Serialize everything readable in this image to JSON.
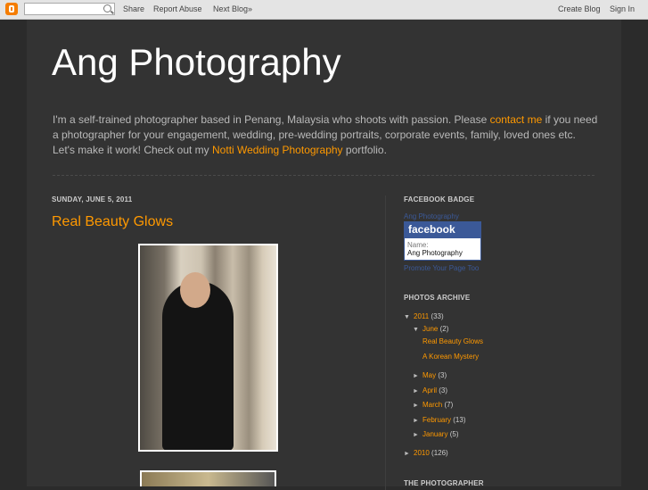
{
  "navbar": {
    "share": "Share",
    "report": "Report Abuse",
    "next": "Next Blog»",
    "create": "Create Blog",
    "signin": "Sign In",
    "search_placeholder": ""
  },
  "header": {
    "title": "Ang Photography",
    "desc_1": "I'm a self-trained photographer based in Penang, Malaysia who shoots with passion. Please ",
    "contact_link": "contact me",
    "desc_2": " if you need a photographer for your engagement, wedding, pre-wedding portraits, corporate events, family, loved ones etc. Let's make it work! Check out my ",
    "notti_link": "Notti Wedding Photography",
    "desc_3": " portfolio."
  },
  "post": {
    "date": "SUNDAY, JUNE 5, 2011",
    "title": "Real Beauty Glows"
  },
  "sidebar": {
    "fb_head": "FACEBOOK BADGE",
    "fb_link": "Ang Photography",
    "fb_logo": "facebook",
    "fb_name_label": "Name:",
    "fb_name_value": "Ang Photography",
    "fb_promo": "Promote Your Page Too",
    "archive_head": "PHOTOS ARCHIVE",
    "photographer_head": "THE PHOTOGRAPHER",
    "archive": {
      "y2011": "2011",
      "y2011_count": "(33)",
      "june": "June",
      "june_count": "(2)",
      "post1": "Real Beauty Glows",
      "post2": "A Korean Mystery",
      "may": "May",
      "may_count": "(3)",
      "april": "April",
      "april_count": "(3)",
      "march": "March",
      "march_count": "(7)",
      "feb": "February",
      "feb_count": "(13)",
      "jan": "January",
      "jan_count": "(5)",
      "y2010": "2010",
      "y2010_count": "(126)"
    }
  },
  "colors": {
    "accent": "#ff9900",
    "facebook": "#3b5998"
  }
}
